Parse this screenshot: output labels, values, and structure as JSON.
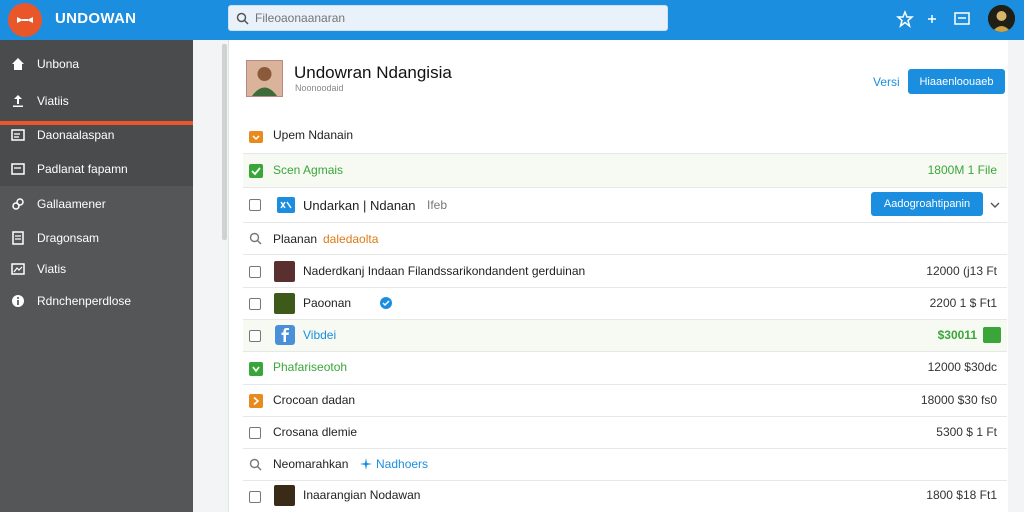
{
  "app": {
    "name": "UNDOWAN"
  },
  "search": {
    "placeholder": "Fileoaonaanaran"
  },
  "sidebar": {
    "items": [
      {
        "label": "Unbona",
        "icon": "home-icon"
      },
      {
        "label": "Viatiis",
        "icon": "upload-icon"
      },
      {
        "label": "Daonaalaspan",
        "icon": "window-icon"
      },
      {
        "label": "Padlanat fapamn",
        "icon": "window-icon"
      },
      {
        "label": "Gallaamener",
        "icon": "link-icon"
      },
      {
        "label": "Dragonsam",
        "icon": "document-icon"
      },
      {
        "label": "Viatis",
        "icon": "image-icon"
      },
      {
        "label": "Rdnchenperdlose",
        "icon": "info-icon"
      }
    ]
  },
  "header": {
    "title": "Undowran Ndangisia",
    "subtitle": "Noonoodaid",
    "versi_label": "Versi",
    "primary_button": "Hiaaenloouaeb"
  },
  "rows": [
    {
      "text": "Upem Ndanain",
      "accent": "",
      "value": ""
    },
    {
      "text": "Scen Agmais",
      "value": "1800M 1 File"
    },
    {
      "text": "Undarkan | Ndanan",
      "hint": "Ifeb",
      "button": "Aadogroahtipanin"
    },
    {
      "text": "Plaanan",
      "accent": "daledaolta"
    },
    {
      "text": "Naderdkanj Indaan Filandssarikondandent gerduinan",
      "value": "12000 (j13 Ft"
    },
    {
      "text": "Paoonan",
      "value": "2200 1 $ Ft1"
    },
    {
      "text": "Vibdei",
      "value": "$30011"
    },
    {
      "text": "Phafariseotoh",
      "value": "12000 $30dc"
    },
    {
      "text": "Crocoan dadan",
      "value": "18000 $30 fs0"
    },
    {
      "text": "Crosana dlemie",
      "value": "5300 $ 1 Ft"
    },
    {
      "text": "Neomarahkan",
      "accent": "Nadhoers"
    },
    {
      "text": "Inaarangian Nodawan",
      "value": "1800 $18 Ft1"
    }
  ],
  "colors": {
    "accent": "#1b8ee0",
    "brand": "#e8562a",
    "green": "#3aa639",
    "orange": "#e07b14"
  }
}
